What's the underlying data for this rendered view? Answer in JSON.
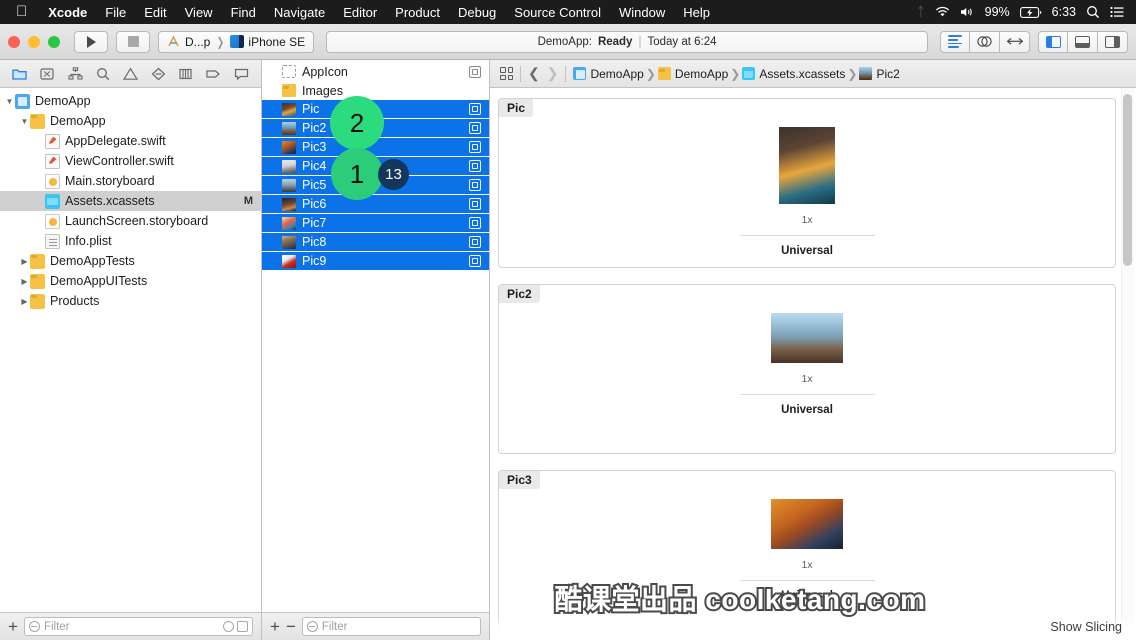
{
  "menubar": {
    "apple": "",
    "items": [
      "Xcode",
      "File",
      "Edit",
      "View",
      "Find",
      "Navigate",
      "Editor",
      "Product",
      "Debug",
      "Source Control",
      "Window",
      "Help"
    ],
    "status_right": {
      "bluetooth_icon": "bluetooth-icon",
      "wifi_icon": "wifi-icon",
      "volume_icon": "volume-icon",
      "battery_percent": "99%",
      "battery_icon": "battery-charging-icon",
      "clock": "6:33",
      "search_icon": "spotlight-search-icon",
      "list_icon": "control-center-icon"
    }
  },
  "toolbar": {
    "run_label": "run-button",
    "stop_label": "stop-button",
    "scheme_project": "D...p",
    "scheme_destination": "iPhone SE",
    "status_app": "DemoApp:",
    "status_state": "Ready",
    "status_time": "Today at 6:24",
    "editor_modes": [
      "standard-editor",
      "assistant-editor",
      "version-editor"
    ],
    "panel_toggles": [
      "navigator-toggle",
      "debug-area-toggle",
      "utilities-toggle"
    ]
  },
  "navigator": {
    "tabs": [
      "project-navigator",
      "source-control-navigator",
      "symbol-navigator",
      "find-navigator",
      "issue-navigator",
      "test-navigator",
      "debug-navigator",
      "breakpoint-navigator",
      "report-navigator"
    ],
    "active_tab": 0,
    "tree": [
      {
        "label": "DemoApp",
        "indent": 0,
        "icon": "project",
        "twisty": "down",
        "modified": ""
      },
      {
        "label": "DemoApp",
        "indent": 1,
        "icon": "folder",
        "twisty": "down",
        "modified": ""
      },
      {
        "label": "AppDelegate.swift",
        "indent": 2,
        "icon": "swift",
        "twisty": "none",
        "modified": ""
      },
      {
        "label": "ViewController.swift",
        "indent": 2,
        "icon": "swift",
        "twisty": "none",
        "modified": ""
      },
      {
        "label": "Main.storyboard",
        "indent": 2,
        "icon": "storyboard",
        "twisty": "none",
        "modified": ""
      },
      {
        "label": "Assets.xcassets",
        "indent": 2,
        "icon": "xcassets",
        "twisty": "none",
        "modified": "M",
        "selected": true
      },
      {
        "label": "LaunchScreen.storyboard",
        "indent": 2,
        "icon": "storyboard",
        "twisty": "none",
        "modified": ""
      },
      {
        "label": "Info.plist",
        "indent": 2,
        "icon": "plist",
        "twisty": "none",
        "modified": ""
      },
      {
        "label": "DemoAppTests",
        "indent": 1,
        "icon": "folder",
        "twisty": "right",
        "modified": ""
      },
      {
        "label": "DemoAppUITests",
        "indent": 1,
        "icon": "folder",
        "twisty": "right",
        "modified": ""
      },
      {
        "label": "Products",
        "indent": 1,
        "icon": "folder",
        "twisty": "right",
        "modified": ""
      }
    ],
    "filter_placeholder": "Filter",
    "add_button": "+"
  },
  "asset_list": {
    "items": [
      {
        "label": "AppIcon",
        "icon": "appicon-placeholder",
        "selected": false,
        "universal_badge": true
      },
      {
        "label": "Images",
        "icon": "folder",
        "selected": false,
        "universal_badge": false
      },
      {
        "label": "Pic",
        "icon": "thumb-portrait-flowers",
        "selected": true,
        "universal_badge": true
      },
      {
        "label": "Pic2",
        "icon": "thumb-mountain",
        "selected": true,
        "universal_badge": true
      },
      {
        "label": "Pic3",
        "icon": "thumb-autumn-couple",
        "selected": true,
        "universal_badge": true
      },
      {
        "label": "Pic4",
        "icon": "thumb-person-white",
        "selected": true,
        "universal_badge": true
      },
      {
        "label": "Pic5",
        "icon": "thumb-landscape",
        "selected": true,
        "universal_badge": true
      },
      {
        "label": "Pic6",
        "icon": "thumb-dark-portrait",
        "selected": true,
        "universal_badge": true
      },
      {
        "label": "Pic7",
        "icon": "thumb-colorful",
        "selected": true,
        "universal_badge": true
      },
      {
        "label": "Pic8",
        "icon": "thumb-group",
        "selected": true,
        "universal_badge": true
      },
      {
        "label": "Pic9",
        "icon": "thumb-red-object",
        "selected": true,
        "universal_badge": true
      }
    ],
    "filter_placeholder": "Filter",
    "add_button": "+",
    "remove_button": "−"
  },
  "breadcrumb": {
    "grid_icon": "related-items-icon",
    "back_icon": "back-arrow-icon",
    "forward_icon": "forward-arrow-icon",
    "crumbs": [
      {
        "label": "DemoApp",
        "icon": "project"
      },
      {
        "label": "DemoApp",
        "icon": "folder"
      },
      {
        "label": "Assets.xcassets",
        "icon": "xcassets"
      },
      {
        "label": "Pic2",
        "icon": "image"
      }
    ]
  },
  "editor": {
    "image_sets": [
      {
        "name": "Pic",
        "scale": "1x",
        "device": "Universal",
        "thumb": "portrait-woman-flowers",
        "thumb_w": 56,
        "thumb_h": 77
      },
      {
        "name": "Pic2",
        "scale": "1x",
        "device": "Universal",
        "thumb": "mountain-landscape",
        "thumb_w": 72,
        "thumb_h": 50
      },
      {
        "name": "Pic3",
        "scale": "1x",
        "device": "Universal",
        "thumb": "autumn-couple",
        "thumb_w": 72,
        "thumb_h": 50
      }
    ],
    "show_slicing": "Show Slicing"
  },
  "watermark": "酷课堂出品 coolketang.com",
  "annotations": [
    {
      "id": "badge2",
      "label": "2",
      "color": "#2ddb7f"
    },
    {
      "id": "badge1",
      "label": "1",
      "color": "#2bcd7a"
    },
    {
      "id": "badge13",
      "label": "13",
      "color": "#15365c"
    }
  ],
  "colors": {
    "selection_blue": "#0b72e7",
    "accent": "#2b7fe0",
    "menubar_bg": "#1c1c1c"
  }
}
